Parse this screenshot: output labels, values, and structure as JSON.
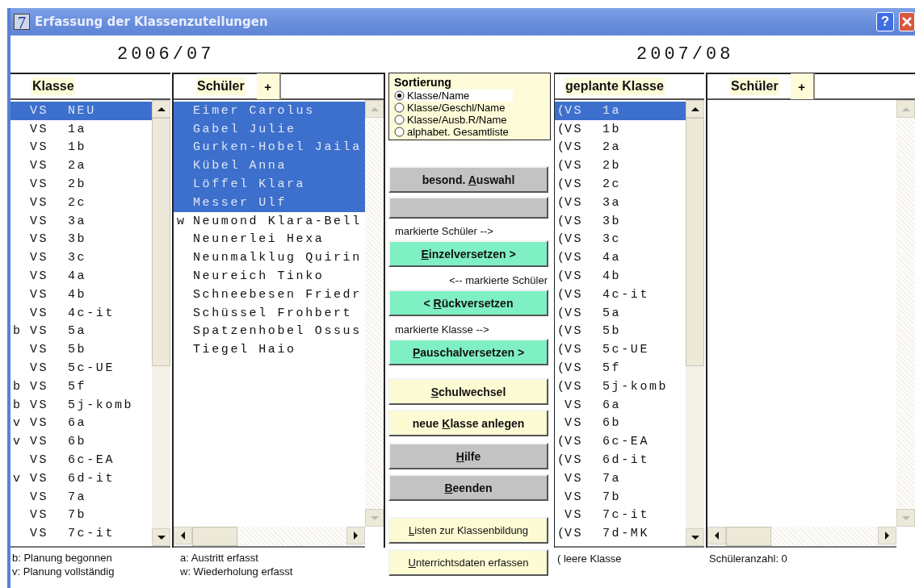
{
  "window": {
    "icon_text": "7",
    "title": "Erfassung der Klassenzuteilungen",
    "help": "?"
  },
  "current_year": {
    "label": "2006/07",
    "class_header": "Klasse",
    "student_header": "Schüler",
    "add_label": "+",
    "classes": [
      {
        "school": "VS",
        "name": "NEU",
        "selected": true
      },
      {
        "school": "VS",
        "name": "1a",
        "selected": false
      },
      {
        "school": "VS",
        "name": "1b",
        "selected": false
      },
      {
        "school": "VS",
        "name": "2a",
        "selected": false
      },
      {
        "school": "VS",
        "name": "2b",
        "selected": false
      },
      {
        "school": "VS",
        "name": "2c",
        "selected": false
      },
      {
        "school": "VS",
        "name": "3a",
        "selected": false
      },
      {
        "school": "VS",
        "name": "3b",
        "selected": false
      },
      {
        "school": "VS",
        "name": "3c",
        "selected": false
      },
      {
        "school": "VS",
        "name": "4a",
        "selected": false
      },
      {
        "school": "VS",
        "name": "4b",
        "selected": false
      },
      {
        "school": "VS",
        "name": "4c-it",
        "selected": false
      },
      {
        "mark": "b",
        "school": "VS",
        "name": "5a",
        "selected": false
      },
      {
        "school": "VS",
        "name": "5b",
        "selected": false
      },
      {
        "school": "VS",
        "name": "5c-UE",
        "selected": false
      },
      {
        "mark": "b",
        "school": "VS",
        "name": "5f",
        "selected": false
      },
      {
        "mark": "b",
        "school": "VS",
        "name": "5j-komb",
        "selected": false
      },
      {
        "mark": "v",
        "school": "VS",
        "name": "6a",
        "selected": false
      },
      {
        "mark": "v",
        "school": "VS",
        "name": "6b",
        "selected": false
      },
      {
        "school": "VS",
        "name": "6c-EA",
        "selected": false
      },
      {
        "mark": "v",
        "school": "VS",
        "name": "6d-it",
        "selected": false
      },
      {
        "school": "VS",
        "name": "7a",
        "selected": false
      },
      {
        "school": "VS",
        "name": "7b",
        "selected": false
      },
      {
        "school": "VS",
        "name": "7c-it",
        "selected": false
      }
    ],
    "students": [
      {
        "name": "Eimer Carolus",
        "selected": true
      },
      {
        "name": "Gabel Julie",
        "selected": true
      },
      {
        "name": "Gurken-Hobel Jaila",
        "selected": true
      },
      {
        "name": "Kübel Anna",
        "selected": true
      },
      {
        "name": "Löffel Klara",
        "selected": true
      },
      {
        "name": "Messer Ulf",
        "selected": true
      },
      {
        "mark": "w",
        "name": "Neumond Klara-Bell",
        "selected": false
      },
      {
        "name": "Neunerlei Hexa",
        "selected": false
      },
      {
        "name": "Neunmalklug Quirin",
        "selected": false
      },
      {
        "name": "Neureich Tinko",
        "selected": false
      },
      {
        "name": "Schneebesen Friedr",
        "selected": false
      },
      {
        "name": "Schüssel Frohbert",
        "selected": false
      },
      {
        "name": "Spatzenhobel Ossus",
        "selected": false
      },
      {
        "name": "Tiegel Haio",
        "selected": false
      }
    ],
    "legend": [
      "b: Planung begonnen",
      "v: Planung vollständig",
      "a: Austritt erfasst",
      "w: Wiederholung erfasst"
    ]
  },
  "sorting": {
    "title": "Sortierung",
    "options": [
      {
        "label": "Klasse/Name",
        "selected": true
      },
      {
        "label": "Klasse/Geschl/Name",
        "selected": false
      },
      {
        "label": "Klasse/Ausb.R/Name",
        "selected": false
      },
      {
        "label": "alphabet. Gesamtliste",
        "selected": false
      }
    ]
  },
  "controls": [
    {
      "kind": "gray-button",
      "before": "besond. ",
      "key": "A",
      "after": "uswahl"
    },
    {
      "kind": "blank"
    },
    {
      "kind": "hint-left",
      "text": "markierte Schüler  -->"
    },
    {
      "kind": "green-button",
      "key": "E",
      "after": "inzelversetzen >"
    },
    {
      "kind": "hint-right",
      "text": "<-- markierte Schüler"
    },
    {
      "kind": "green-button",
      "before": "< ",
      "key": "R",
      "after": "ückversetzen"
    },
    {
      "kind": "hint-left",
      "text": "markierte Klasse -->"
    },
    {
      "kind": "green-button",
      "key": "P",
      "after": "auschalversetzen >"
    },
    {
      "kind": "yellow-button",
      "key": "S",
      "after": "chulwechsel"
    },
    {
      "kind": "yellow-button",
      "before": "neue ",
      "key": "K",
      "after": "lasse anlegen"
    },
    {
      "kind": "gray-button",
      "key": "H",
      "after": "ilfe"
    },
    {
      "kind": "gray-button",
      "key": "B",
      "after": "eenden"
    },
    {
      "kind": "link-button",
      "key": "L",
      "after": "isten zur Klassenbildung"
    },
    {
      "kind": "link-button",
      "key": "U",
      "after": "nterrichtsdaten erfassen"
    }
  ],
  "next_year": {
    "label": "2007/08",
    "class_header": "geplante Klasse",
    "student_header": "Schüler",
    "add_label": "+",
    "classes": [
      {
        "prefix": "(",
        "school": "VS",
        "name": "1a",
        "selected": true
      },
      {
        "prefix": "(",
        "school": "VS",
        "name": "1b",
        "selected": false
      },
      {
        "prefix": "(",
        "school": "VS",
        "name": "2a",
        "selected": false
      },
      {
        "prefix": "(",
        "school": "VS",
        "name": "2b",
        "selected": false
      },
      {
        "prefix": "(",
        "school": "VS",
        "name": "2c",
        "selected": false
      },
      {
        "prefix": "(",
        "school": "VS",
        "name": "3a",
        "selected": false
      },
      {
        "prefix": "(",
        "school": "VS",
        "name": "3b",
        "selected": false
      },
      {
        "prefix": "(",
        "school": "VS",
        "name": "3c",
        "selected": false
      },
      {
        "prefix": "(",
        "school": "VS",
        "name": "4a",
        "selected": false
      },
      {
        "prefix": "(",
        "school": "VS",
        "name": "4b",
        "selected": false
      },
      {
        "prefix": "(",
        "school": "VS",
        "name": "4c-it",
        "selected": false
      },
      {
        "prefix": "(",
        "school": "VS",
        "name": "5a",
        "selected": false
      },
      {
        "prefix": "(",
        "school": "VS",
        "name": "5b",
        "selected": false
      },
      {
        "prefix": "(",
        "school": "VS",
        "name": "5c-UE",
        "selected": false
      },
      {
        "prefix": "(",
        "school": "VS",
        "name": "5f",
        "selected": false
      },
      {
        "prefix": "(",
        "school": "VS",
        "name": "5j-komb",
        "selected": false
      },
      {
        "school": "VS",
        "name": "6a",
        "selected": false
      },
      {
        "school": "VS",
        "name": "6b",
        "selected": false
      },
      {
        "prefix": "(",
        "school": "VS",
        "name": "6c-EA",
        "selected": false
      },
      {
        "prefix": "(",
        "school": "VS",
        "name": "6d-it",
        "selected": false
      },
      {
        "school": "VS",
        "name": "7a",
        "selected": false
      },
      {
        "school": "VS",
        "name": "7b",
        "selected": false
      },
      {
        "school": "VS",
        "name": "7c-it",
        "selected": false
      },
      {
        "prefix": "(",
        "school": "VS",
        "name": "7d-MK",
        "selected": false
      }
    ],
    "footer": [
      "( leere Klasse",
      "Schüleranzahl: 0"
    ]
  }
}
